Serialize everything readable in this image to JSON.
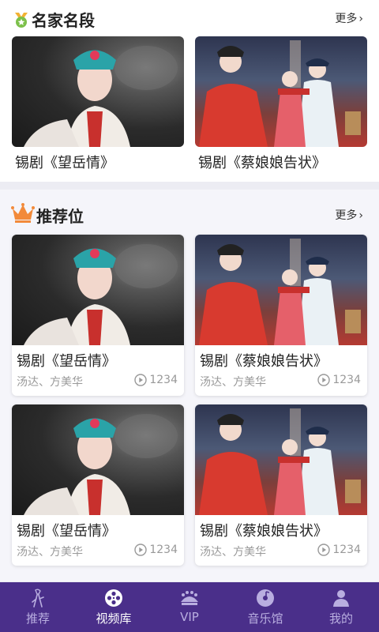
{
  "famous": {
    "title": "名家名段",
    "more": "更多",
    "items": [
      {
        "title": "锡剧《望岳情》"
      },
      {
        "title": "锡剧《蔡娘娘告状》"
      }
    ]
  },
  "recommend": {
    "title": "推荐位",
    "more": "更多",
    "cards": [
      {
        "title": "锡剧《望岳情》",
        "author": "汤达、方美华",
        "plays": "1234"
      },
      {
        "title": "锡剧《蔡娘娘告状》",
        "author": "汤达、方美华",
        "plays": "1234"
      },
      {
        "title": "锡剧《望岳情》",
        "author": "汤达、方美华",
        "plays": "1234"
      },
      {
        "title": "锡剧《蔡娘娘告状》",
        "author": "汤达、方美华",
        "plays": "1234"
      }
    ]
  },
  "tabbar": {
    "items": [
      {
        "label": "推荐",
        "icon": "opera-figure-icon"
      },
      {
        "label": "视频库",
        "icon": "film-reel-icon"
      },
      {
        "label": "VIP",
        "icon": "crown-icon"
      },
      {
        "label": "音乐馆",
        "icon": "music-disc-icon"
      },
      {
        "label": "我的",
        "icon": "person-icon"
      }
    ],
    "active": "视频库"
  },
  "colors": {
    "tabbar_bg": "#4a2f8a",
    "crown": "#f28a3a",
    "medal": "#7cc04a"
  }
}
